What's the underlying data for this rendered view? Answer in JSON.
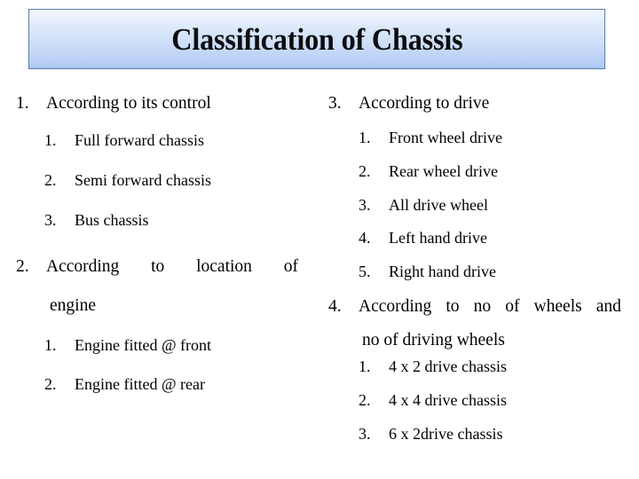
{
  "slide": {
    "title": "Classification of Chassis",
    "title_box": {
      "border_color": "#5a7da5",
      "gradient_top": "#f4f8fe",
      "gradient_bottom": "#a9c6f2"
    },
    "background_color": "#ffffff",
    "text_color": "#000000"
  },
  "left_column": {
    "item_1": {
      "marker": "1.",
      "text": "According to its control",
      "subitems": [
        {
          "marker": "1.",
          "text": "Full forward chassis"
        },
        {
          "marker": "2.",
          "text": "Semi forward chassis"
        },
        {
          "marker": "3.",
          "text": "Bus chassis"
        }
      ]
    },
    "item_2": {
      "marker": "2.",
      "line_1_words": [
        "According",
        "to",
        "location",
        "of"
      ],
      "line_2": "engine",
      "subitems": [
        {
          "marker": "1.",
          "text": "Engine fitted @ front"
        },
        {
          "marker": "2.",
          "text": "Engine fitted @ rear"
        }
      ]
    }
  },
  "right_column": {
    "item_3": {
      "marker": "3.",
      "text": "According to drive",
      "subitems": [
        {
          "marker": "1.",
          "text": "Front wheel drive"
        },
        {
          "marker": "2.",
          "text": "Rear wheel drive"
        },
        {
          "marker": "3.",
          "text": "All drive wheel"
        },
        {
          "marker": "4.",
          "text": "Left hand drive"
        },
        {
          "marker": "5.",
          "text": "Right hand drive"
        }
      ]
    },
    "item_4": {
      "marker": "4.",
      "line_1_words": [
        "According",
        "to",
        "no",
        "of",
        "wheels",
        "and"
      ],
      "line_2": "no of driving wheels",
      "subitems": [
        {
          "marker": "1.",
          "text": "4 x 2 drive chassis"
        },
        {
          "marker": "2.",
          "text": "4 x 4 drive chassis"
        },
        {
          "marker": "3.",
          "text": "6 x 2drive chassis"
        }
      ]
    }
  }
}
